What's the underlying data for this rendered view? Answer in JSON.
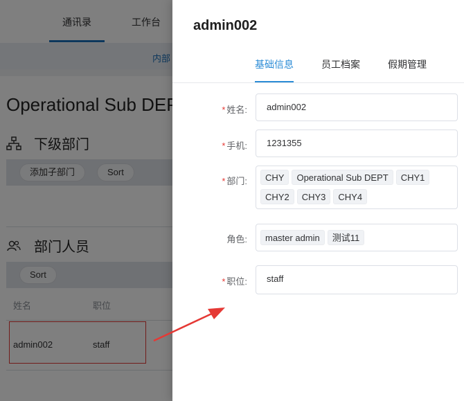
{
  "background": {
    "nav": [
      "通讯录",
      "工作台"
    ],
    "subnav_link": "内部",
    "dept_title": "Operational Sub DEPT",
    "sub_section": {
      "title": "下级部门",
      "buttons": [
        "添加子部门",
        "Sort"
      ]
    },
    "people_section": {
      "title": "部门人员",
      "sort_button": "Sort",
      "columns": [
        "姓名",
        "职位"
      ],
      "rows": [
        {
          "name": "admin002",
          "position": "staff"
        }
      ]
    }
  },
  "drawer": {
    "title": "admin002",
    "tabs": [
      "基础信息",
      "员工档案",
      "假期管理"
    ],
    "form": {
      "name": {
        "label": "姓名:",
        "required": "*",
        "value": "admin002"
      },
      "phone": {
        "label": "手机:",
        "required": "*",
        "value": "1231355"
      },
      "dept": {
        "label": "部门:",
        "required": "*",
        "tags": [
          "CHY",
          "Operational Sub DEPT",
          "CHY1",
          "CHY2",
          "CHY3",
          "CHY4"
        ]
      },
      "role": {
        "label": "角色:",
        "tags": [
          "master admin",
          "测试11"
        ]
      },
      "position": {
        "label": "职位:",
        "required": "*",
        "value": "staff"
      }
    }
  },
  "colors": {
    "accent": "#2a8bd6",
    "required": "#e53935",
    "annotation": "#e53935"
  }
}
